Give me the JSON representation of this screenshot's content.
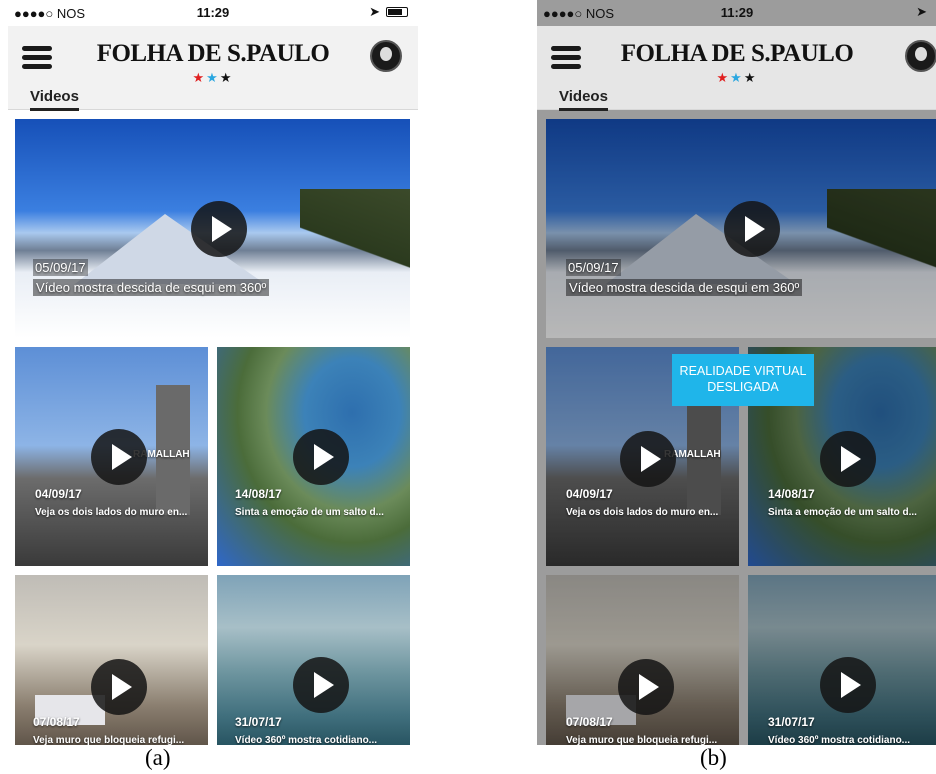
{
  "status_bar": {
    "carrier": "●●●●○ NOS",
    "time": "11:29"
  },
  "header": {
    "logo": "FOLHA DE S.PAULO",
    "stars": [
      "★",
      "★",
      "★"
    ],
    "tab": "Videos"
  },
  "videos": [
    {
      "date": "05/09/17",
      "caption": "Vídeo mostra descida de esqui em 360º"
    },
    {
      "date": "04/09/17",
      "caption": "Veja os dois lados do muro en..."
    },
    {
      "date": "14/08/17",
      "caption": "Sinta a emoção de um salto d..."
    },
    {
      "date": "07/08/17",
      "caption": "Veja muro que bloqueia refugi..."
    },
    {
      "date": "31/07/17",
      "caption": "Vídeo 360º mostra cotidiano..."
    }
  ],
  "overlay_text": {
    "ramallah": "RAMALLAH"
  },
  "toast": {
    "line1": "REALIDADE VIRTUAL",
    "line2": "DESLIGADA"
  },
  "toast_color": "#1fb5ea",
  "subfigure_labels": {
    "a": "(a)",
    "b": "(b)"
  },
  "icons": [
    "hamburger-menu-icon",
    "avatar-icon",
    "play-icon",
    "wifi-icon",
    "location-arrow-icon",
    "battery-icon"
  ]
}
